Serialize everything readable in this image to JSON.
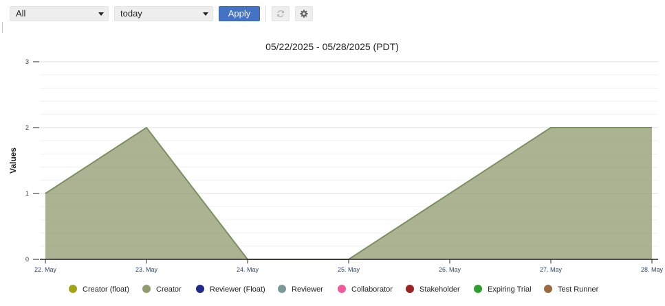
{
  "toolbar": {
    "filter_value": "All",
    "range_value": "today",
    "apply_label": "Apply"
  },
  "chart_data": {
    "type": "area",
    "title": "05/22/2025 - 05/28/2025 (PDT)",
    "xlabel": "",
    "ylabel": "Values",
    "categories": [
      "22. May",
      "23. May",
      "24. May",
      "25. May",
      "26. May",
      "27. May",
      "28. May"
    ],
    "ylim": [
      0,
      3
    ],
    "yticks": [
      0,
      1,
      2,
      3
    ],
    "grid": true,
    "legend_position": "bottom",
    "series": [
      {
        "name": "Creator (float)",
        "color": "#a3a31a",
        "values": [
          0,
          0,
          0,
          0,
          0,
          0,
          0
        ]
      },
      {
        "name": "Creator",
        "color": "#8f9a6d",
        "values": [
          1,
          2,
          0,
          0,
          1,
          2,
          2
        ]
      },
      {
        "name": "Reviewer (Float)",
        "color": "#1e2a8c",
        "values": [
          0,
          0,
          0,
          0,
          0,
          0,
          0
        ]
      },
      {
        "name": "Reviewer",
        "color": "#7b9898",
        "values": [
          0,
          0,
          0,
          0,
          0,
          0,
          0
        ]
      },
      {
        "name": "Collaborator",
        "color": "#f05a9a",
        "values": [
          0,
          0,
          0,
          0,
          0,
          0,
          0
        ]
      },
      {
        "name": "Stakeholder",
        "color": "#9c2222",
        "values": [
          0,
          0,
          0,
          0,
          0,
          0,
          0
        ]
      },
      {
        "name": "Expiring Trial",
        "color": "#2e9e2e",
        "values": [
          0,
          0,
          0,
          0,
          0,
          0,
          0
        ]
      },
      {
        "name": "Test Runner",
        "color": "#9c6a3f",
        "values": [
          0,
          0,
          0,
          0,
          0,
          0,
          0
        ]
      }
    ]
  }
}
